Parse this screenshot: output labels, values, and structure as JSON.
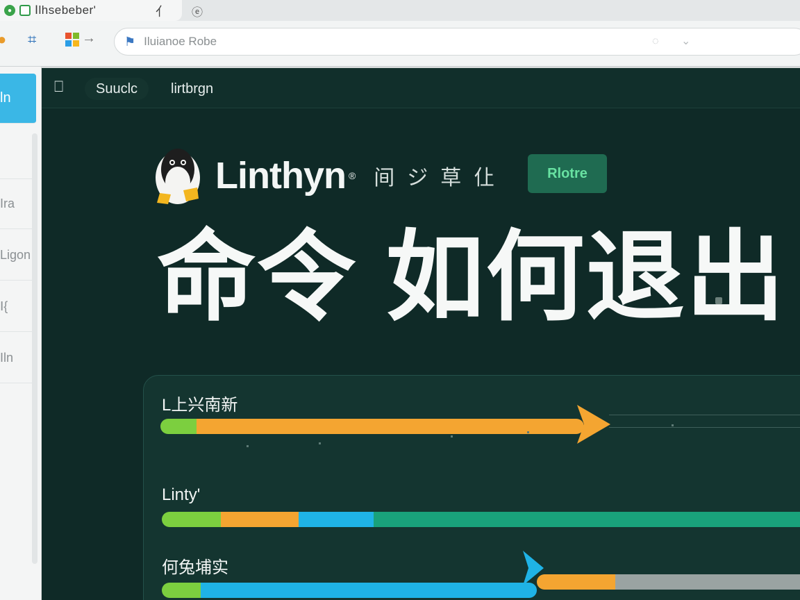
{
  "browser": {
    "tab_title": "Ⅰlhsebeber'",
    "tab_tool_glyph": "⺅",
    "tab2_glyph": "ⓔ",
    "url_text": "Iluianoe Robe"
  },
  "sidebar": {
    "items": [
      {
        "label": "ln",
        "active": true
      },
      {
        "label": ""
      },
      {
        "label": "Ira"
      },
      {
        "label": "Ligon"
      },
      {
        "label": "Ⅰ{"
      },
      {
        "label": "Iln"
      }
    ]
  },
  "nav": {
    "items": [
      {
        "label": "Suuclc",
        "active": true
      },
      {
        "label": "lirtbrgn",
        "active": false
      }
    ]
  },
  "brand": {
    "name": "Linthyn",
    "reg_mark": "®",
    "tags": "间ジ草仩",
    "button_label": "Rlotre"
  },
  "headline": "命令 如何退出",
  "rows": [
    {
      "label": "L上兴南新",
      "segments": [
        {
          "color": "#7ccf3f",
          "share": 0.085
        },
        {
          "color": "#f4a531",
          "share": 0.915
        }
      ],
      "arrow_color": "#f4a531"
    },
    {
      "label": "Linty'",
      "segments": [
        {
          "color": "#7ccf3f",
          "share": 0.09
        },
        {
          "color": "#f4a531",
          "share": 0.12
        },
        {
          "color": "#1fb3e6",
          "share": 0.115
        },
        {
          "color": "#19a27b",
          "share": 0.675
        }
      ]
    },
    {
      "label": "何兔埔实",
      "segments": [
        {
          "color": "#7ccf3f",
          "share": 0.07
        },
        {
          "color": "#1fb3e6",
          "share": 0.61
        },
        {
          "color": "#f4a531",
          "share": 0.09
        },
        {
          "color": "#9aa3a2",
          "share": 0.23
        }
      ],
      "arrow_color": "#1fb3e6"
    }
  ],
  "colors": {
    "page_bg": "#0f2a27",
    "accent_green": "#68e2a2",
    "sidebar_active": "#3ab7e6"
  }
}
